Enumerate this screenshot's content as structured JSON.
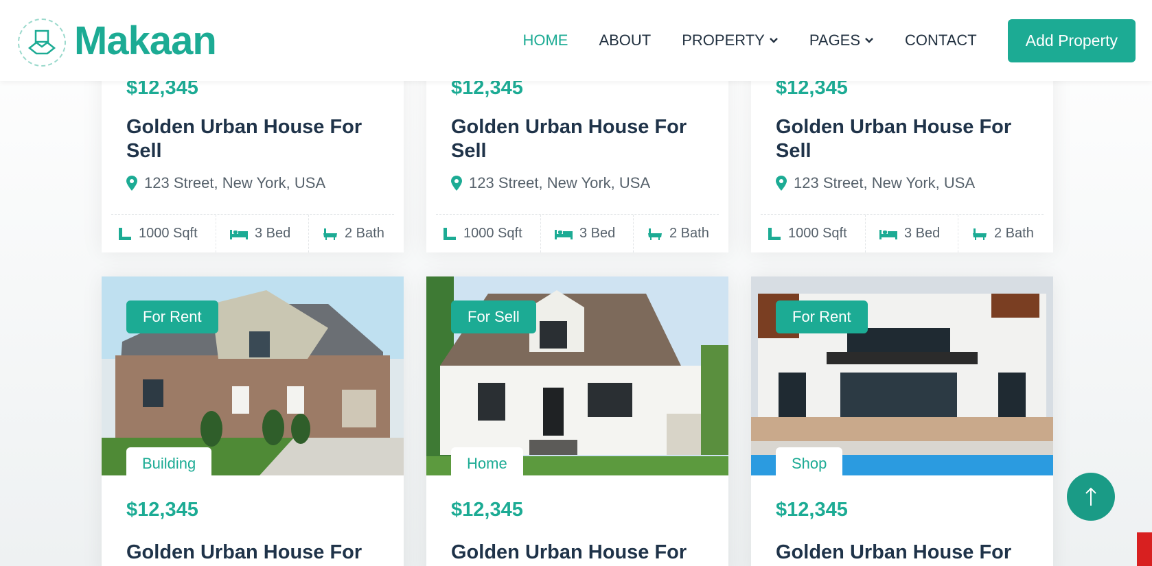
{
  "brand": {
    "name": "Makaan"
  },
  "nav": {
    "home": "HOME",
    "about": "ABOUT",
    "property": "PROPERTY",
    "pages": "PAGES",
    "contact": "CONTACT",
    "add_property": "Add Property"
  },
  "colors": {
    "accent": "#1cab94",
    "heading": "#1f3349"
  },
  "top_cards": [
    {
      "price": "$12,345",
      "title": "Golden Urban House For Sell",
      "address": "123 Street, New York, USA",
      "area": "1000 Sqft",
      "bed": "3 Bed",
      "bath": "2 Bath"
    },
    {
      "price": "$12,345",
      "title": "Golden Urban House For Sell",
      "address": "123 Street, New York, USA",
      "area": "1000 Sqft",
      "bed": "3 Bed",
      "bath": "2 Bath"
    },
    {
      "price": "$12,345",
      "title": "Golden Urban House For Sell",
      "address": "123 Street, New York, USA",
      "area": "1000 Sqft",
      "bed": "3 Bed",
      "bath": "2 Bath"
    }
  ],
  "bottom_cards": [
    {
      "status": "For Rent",
      "type": "Building",
      "price": "$12,345",
      "title": "Golden Urban House For"
    },
    {
      "status": "For Sell",
      "type": "Home",
      "price": "$12,345",
      "title": "Golden Urban House For"
    },
    {
      "status": "For Rent",
      "type": "Shop",
      "price": "$12,345",
      "title": "Golden Urban House For"
    }
  ]
}
